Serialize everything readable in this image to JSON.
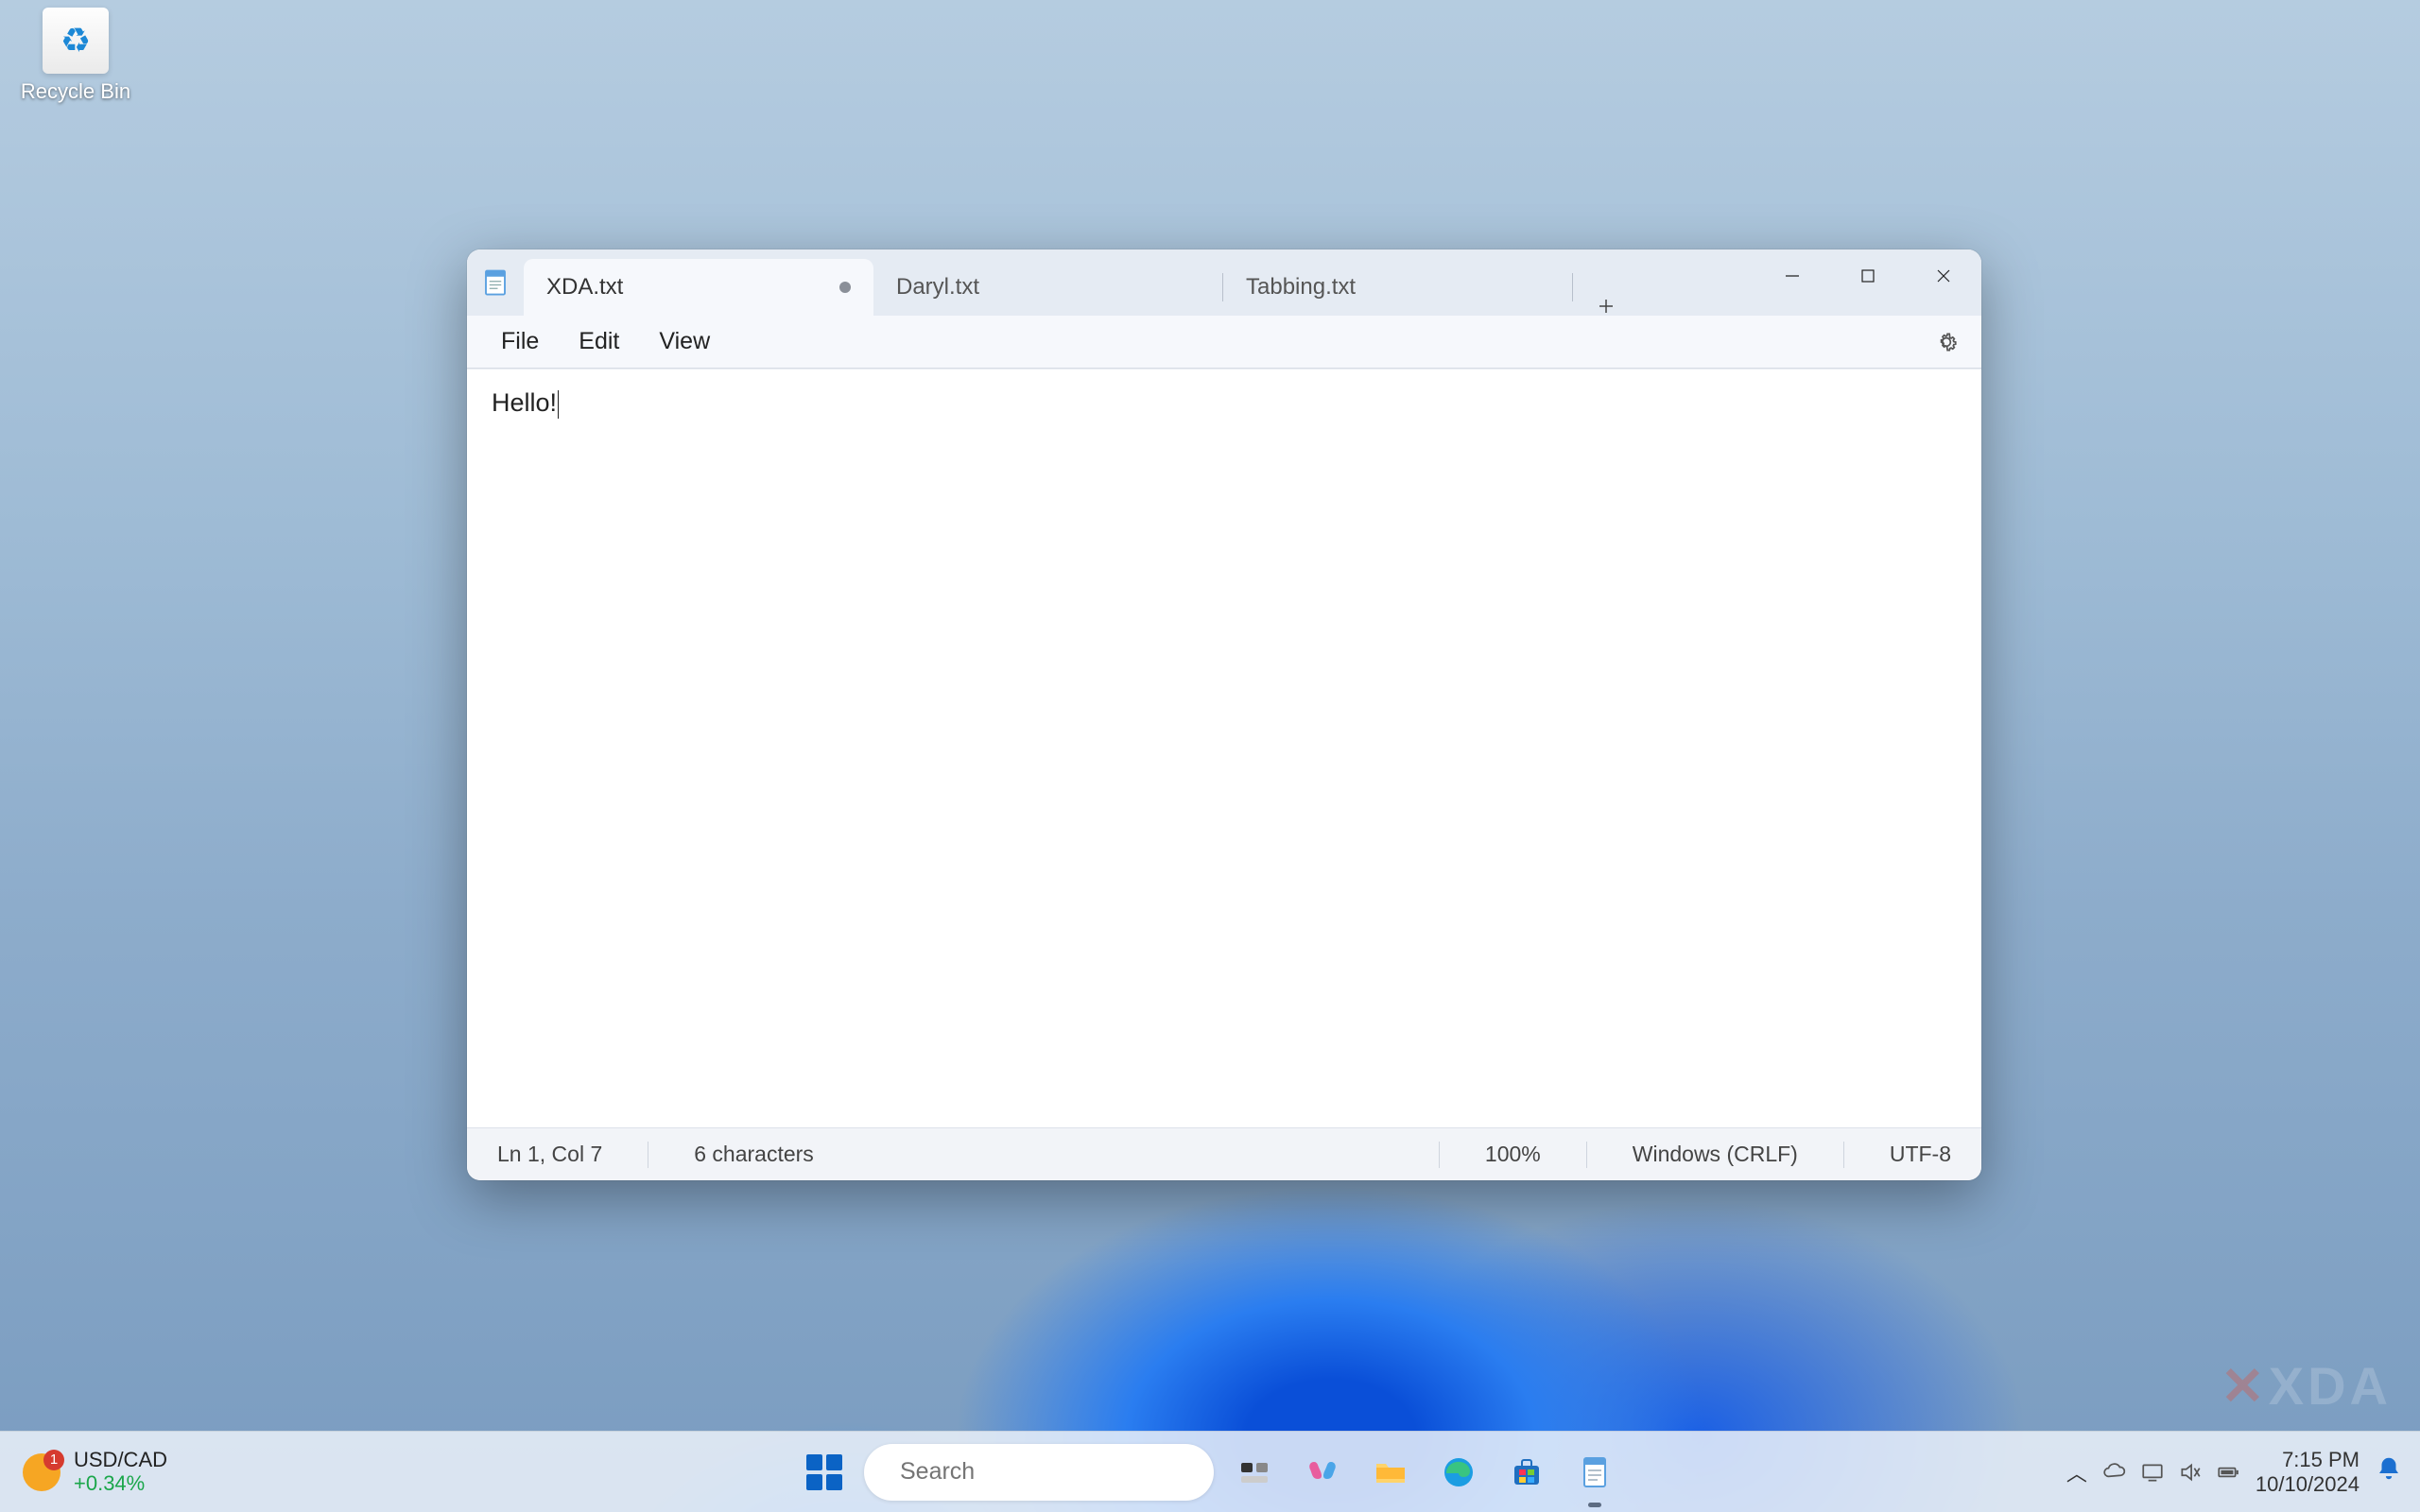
{
  "desktop": {
    "recycle_bin_label": "Recycle Bin"
  },
  "notepad": {
    "tabs": [
      {
        "label": "XDA.txt",
        "unsaved": true,
        "active": true
      },
      {
        "label": "Daryl.txt",
        "unsaved": false,
        "active": false
      },
      {
        "label": "Tabbing.txt",
        "unsaved": false,
        "active": false
      }
    ],
    "menu": {
      "file": "File",
      "edit": "Edit",
      "view": "View"
    },
    "content": "Hello!",
    "status": {
      "position": "Ln 1, Col 7",
      "chars": "6 characters",
      "zoom": "100%",
      "line_ending": "Windows (CRLF)",
      "encoding": "UTF-8"
    }
  },
  "taskbar": {
    "widget": {
      "symbol": "USD/CAD",
      "change": "+0.34%"
    },
    "search_placeholder": "Search",
    "time": "7:15 PM",
    "date": "10/10/2024"
  },
  "watermark": "XDA"
}
